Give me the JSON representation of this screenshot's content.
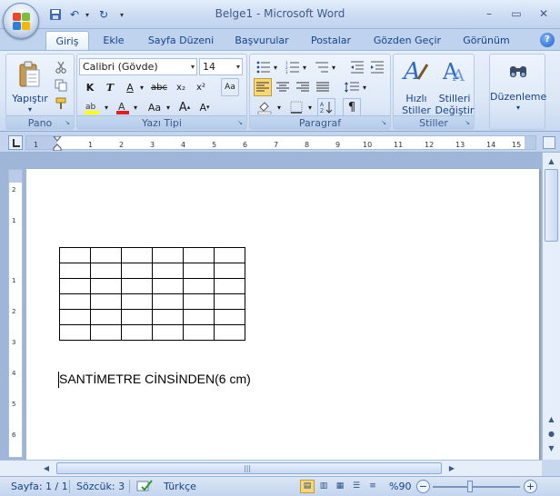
{
  "window": {
    "title": "Belge1 - Microsoft Word",
    "minimize_label": "–",
    "maximize_label": "▭",
    "close_label": "✕"
  },
  "qat": {
    "save_icon": "💾",
    "undo_icon": "↶",
    "redo_icon": "↻",
    "customize_icon": "▾"
  },
  "tabs": [
    {
      "label": "Giriş",
      "active": true
    },
    {
      "label": "Ekle"
    },
    {
      "label": "Sayfa Düzeni"
    },
    {
      "label": "Başvurular"
    },
    {
      "label": "Postalar"
    },
    {
      "label": "Gözden Geçir"
    },
    {
      "label": "Görünüm"
    }
  ],
  "ribbon": {
    "pano": {
      "label": "Pano",
      "paste_label": "Yapıştır"
    },
    "font": {
      "label": "Yazı Tipi",
      "font_name": "Calibri (Gövde)",
      "font_size": "14"
    },
    "paragraph": {
      "label": "Paragraf"
    },
    "styles": {
      "label": "Stiller",
      "quick_styles": "Hızlı\nStiller",
      "change_styles": "Stilleri\nDeğiştir"
    },
    "editing": {
      "label": "Düzenleme"
    }
  },
  "ruler": {
    "h_ticks": [
      "1",
      "1",
      "2",
      "3",
      "4",
      "5",
      "6",
      "7",
      "8",
      "9",
      "10",
      "11",
      "12",
      "13",
      "14",
      "15"
    ],
    "v_ticks": [
      "2",
      "1",
      "1",
      "2",
      "3",
      "4",
      "5",
      "6"
    ]
  },
  "document": {
    "table": {
      "rows": 6,
      "cols": 6
    },
    "text": "SANTİMETRE CİNSİNDEN(6 cm)"
  },
  "status": {
    "page": "Sayfa: 1 / 1",
    "words": "Sözcük: 3",
    "language": "Türkçe",
    "zoom": "%90"
  },
  "colors": {
    "accent": "#15428b",
    "ribbon_bg": "#dce7f6",
    "active_view": "#fbd873"
  }
}
